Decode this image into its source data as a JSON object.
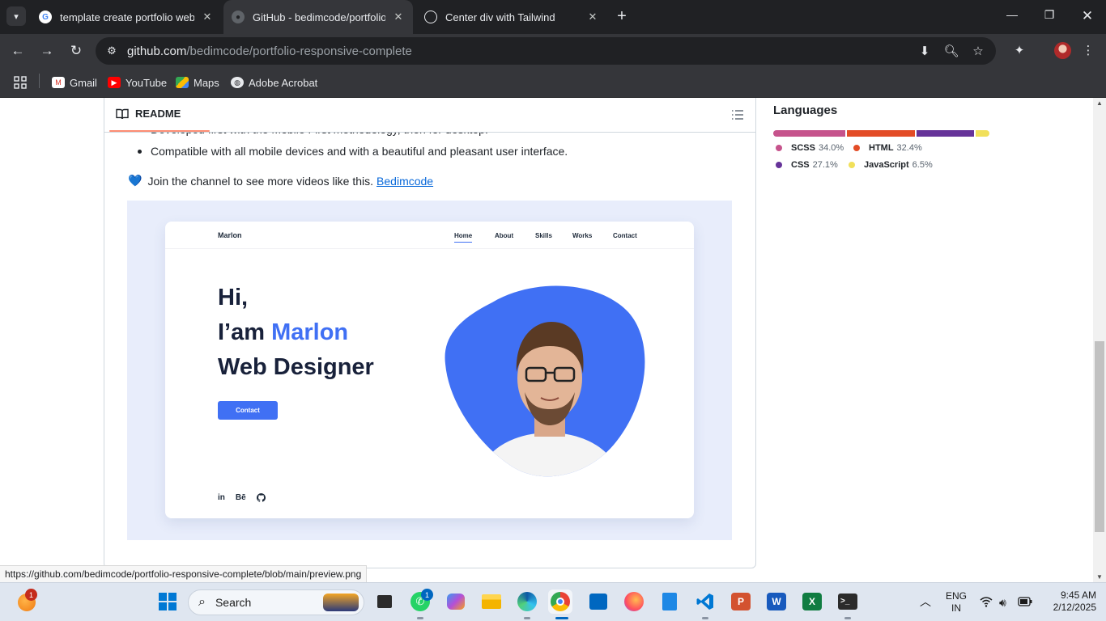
{
  "browser": {
    "tabs": [
      {
        "title": "template create portfolio website",
        "favicon": "google-icon",
        "active": false
      },
      {
        "title": "GitHub - bedimcode/portfolio-responsive-complete",
        "favicon": "github-icon",
        "active": true
      },
      {
        "title": "Center div with Tailwind",
        "favicon": "chatgpt-icon",
        "active": false
      }
    ],
    "url_host": "github.com",
    "url_path": "/bedimcode/portfolio-responsive-complete",
    "bookmarks": [
      {
        "label": "Gmail",
        "icon": "gmail-icon"
      },
      {
        "label": "YouTube",
        "icon": "youtube-icon"
      },
      {
        "label": "Maps",
        "icon": "maps-icon"
      },
      {
        "label": "Adobe Acrobat",
        "icon": "acrobat-icon"
      }
    ]
  },
  "readme": {
    "tab_label": "README",
    "partial_text": "Developed first with the Mobile First methodology, then for desktop.",
    "bullet_text": "Compatible with all mobile devices and with a beautiful and pleasant user interface.",
    "join_text": "Join the channel to see more videos like this.",
    "join_link": "Bedimcode"
  },
  "preview": {
    "logo": "Marlon",
    "nav": [
      "Home",
      "About",
      "Skills",
      "Works",
      "Contact"
    ],
    "hero_line1": "Hi,",
    "hero_line2_prefix": "I’am",
    "hero_line2_name": "Marlon",
    "hero_line3": "Web Designer",
    "button": "Contact",
    "socials": [
      "in",
      "Bē",
      "github"
    ]
  },
  "languages": {
    "title": "Languages",
    "items": [
      {
        "name": "SCSS",
        "percent": "34.0%",
        "value": 34.0,
        "color": "#c6538c"
      },
      {
        "name": "HTML",
        "percent": "32.4%",
        "value": 32.4,
        "color": "#e34c26"
      },
      {
        "name": "CSS",
        "percent": "27.1%",
        "value": 27.1,
        "color": "#663399"
      },
      {
        "name": "JavaScript",
        "percent": "6.5%",
        "value": 6.5,
        "color": "#f1e05a"
      }
    ]
  },
  "status_url": "https://github.com/bedimcode/portfolio-responsive-complete/blob/main/preview.png",
  "taskbar": {
    "search_label": "Search",
    "whatsapp_badge": "1",
    "weather_badge": "1",
    "language": "ENG",
    "region": "IN",
    "time": "9:45 AM",
    "date": "2/12/2025"
  }
}
